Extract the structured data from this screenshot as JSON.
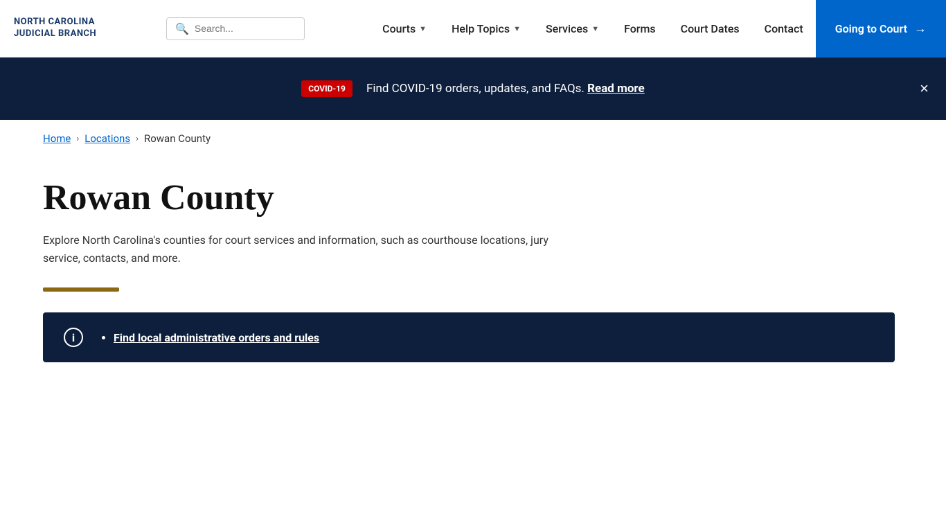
{
  "header": {
    "logo_line1": "NORTH CAROLINA",
    "logo_line2": "JUDICIAL BRANCH",
    "search_placeholder": "Search...",
    "nav_items": [
      {
        "label": "Courts",
        "has_dropdown": true
      },
      {
        "label": "Help Topics",
        "has_dropdown": true
      },
      {
        "label": "Services",
        "has_dropdown": true
      },
      {
        "label": "Forms",
        "has_dropdown": false
      },
      {
        "label": "Court Dates",
        "has_dropdown": false
      },
      {
        "label": "Contact",
        "has_dropdown": false
      }
    ],
    "cta_label": "Going to Court",
    "cta_arrow": "→"
  },
  "covid_banner": {
    "badge_text": "COVID-19",
    "message": "Find COVID-19 orders, updates, and FAQs.",
    "link_text": "Read more",
    "close_label": "×"
  },
  "breadcrumb": {
    "home_label": "Home",
    "locations_label": "Locations",
    "current_label": "Rowan County",
    "separator": "›"
  },
  "main": {
    "page_title": "Rowan County",
    "description": "Explore North Carolina's counties for court services and information, such as courthouse locations, jury service, contacts, and more."
  },
  "info_box": {
    "link_text": "Find local administrative orders and rules"
  },
  "colors": {
    "brand_dark_blue": "#1a3a6b",
    "nav_cta_blue": "#0066cc",
    "banner_dark": "#0d1f3c",
    "covid_red": "#cc0000",
    "accent_gold": "#8b6914"
  }
}
